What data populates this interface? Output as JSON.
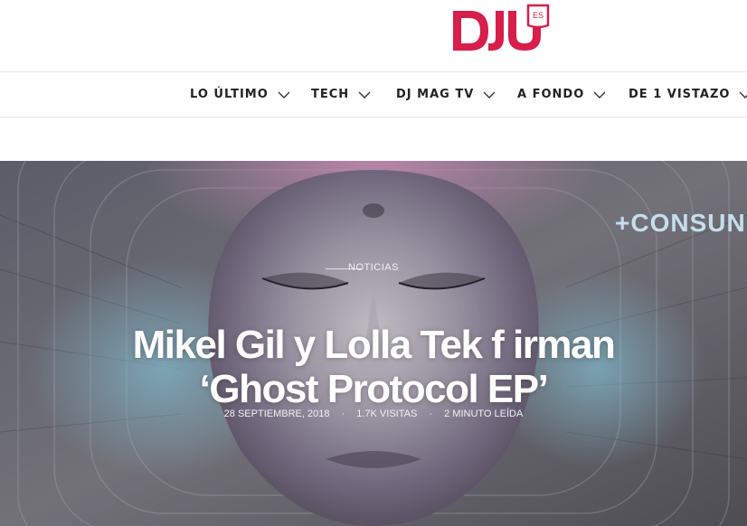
{
  "header": {
    "logo_text": "DJ",
    "logo_badge": "ES"
  },
  "nav": {
    "items": [
      {
        "label": "LO ÚLTIMO"
      },
      {
        "label": "TECH"
      },
      {
        "label": "DJ MAG TV"
      },
      {
        "label": "A FONDO"
      },
      {
        "label": "DE 1 VISTAZO"
      }
    ]
  },
  "article": {
    "category": "NOTICIAS",
    "title_line1": "Mikel Gil y Lolla Tek f irman",
    "title_line2": "‘Ghost Protocol EP’",
    "date": "28 SEPTIEMBRE, 2018",
    "views": "1.7K VISITAS",
    "read_time": "2 MINUTO LEÍDA",
    "separator": "·",
    "image_text": "+CONSUN"
  },
  "colors": {
    "brand": "#d81e4a",
    "nav_text": "#222222",
    "hero_text": "#ffffff"
  }
}
